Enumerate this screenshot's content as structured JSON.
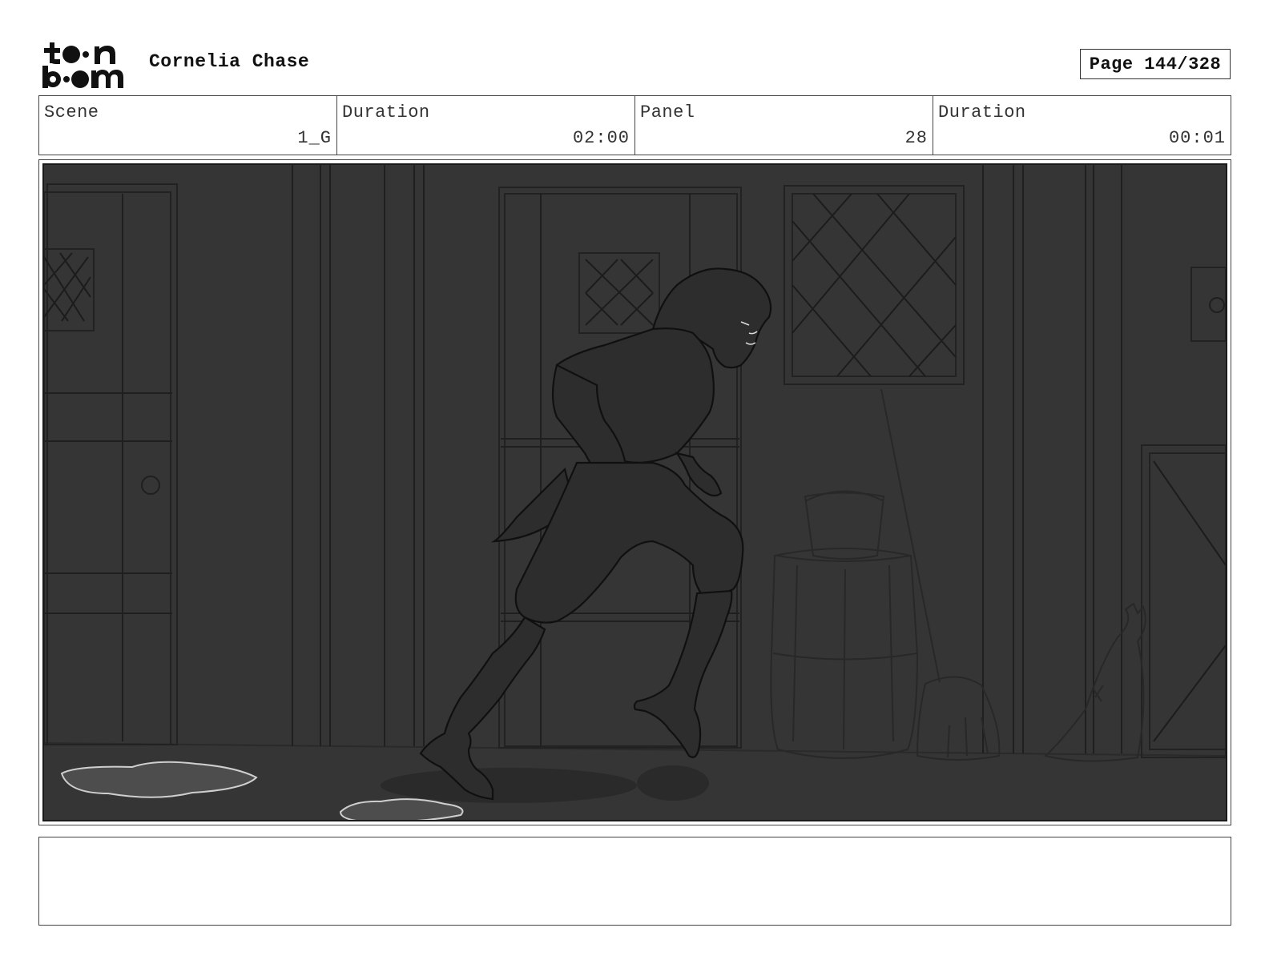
{
  "header": {
    "logo_icon": "toon-boom-logo-icon",
    "project_title": "Cornelia Chase",
    "page_label": "Page 144/328"
  },
  "info": {
    "scene_label": "Scene",
    "scene_value": "1_G",
    "scene_duration_label": "Duration",
    "scene_duration_value": "02:00",
    "panel_label": "Panel",
    "panel_value": "28",
    "panel_duration_label": "Duration",
    "panel_duration_value": "00:01"
  },
  "panel": {
    "image_icon": "storyboard-sketch-image",
    "background_color": "#353535",
    "line_color": "#1a1a1a"
  },
  "notes": {
    "text": ""
  }
}
